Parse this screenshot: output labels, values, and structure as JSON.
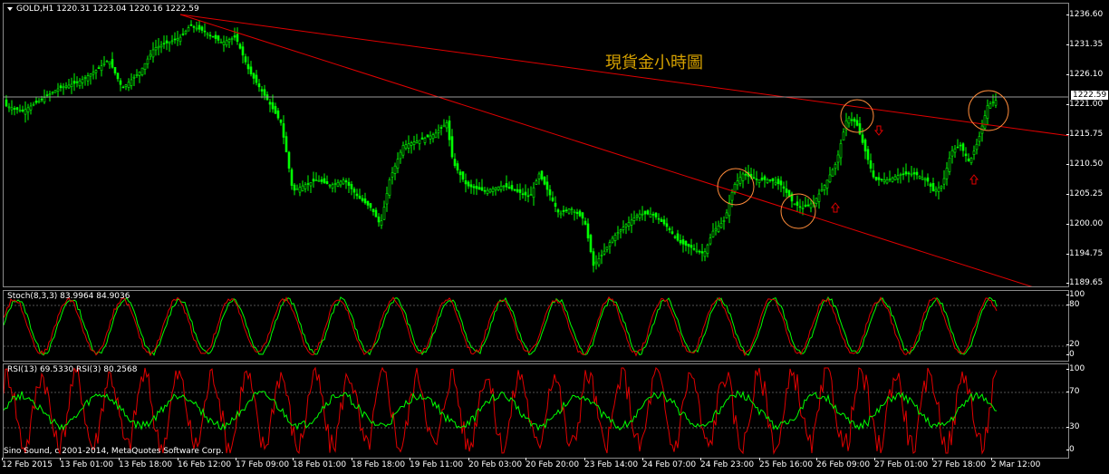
{
  "main": {
    "label": "GOLD,H1  1220.31 1223.04 1220.16 1222.59",
    "title": "現貨金小時圖",
    "current_price": "1222.59",
    "price_ticks": [
      "1236.60",
      "1231.35",
      "1226.10",
      "1221.00",
      "1215.75",
      "1210.50",
      "1205.25",
      "1200.00",
      "1194.75",
      "1189.65"
    ]
  },
  "stoch": {
    "label": "Stoch(8,3,3) 83.9964 84.9036",
    "ticks": [
      "100",
      "80",
      "20",
      "0"
    ]
  },
  "rsi": {
    "label": "RSI(13) 69.5330  RSI(3) 80.2568",
    "ticks": [
      "100",
      "70",
      "30",
      "0"
    ]
  },
  "copyright": "Sino Sound, c 2001-2014, MetaQuotes Software Corp.",
  "time_labels": [
    "12 Feb 2015",
    "13 Feb 01:00",
    "13 Feb 18:00",
    "16 Feb 12:00",
    "17 Feb 09:00",
    "18 Feb 01:00",
    "18 Feb 18:00",
    "19 Feb 11:00",
    "20 Feb 03:00",
    "20 Feb 20:00",
    "23 Feb 14:00",
    "24 Feb 07:00",
    "24 Feb 23:00",
    "25 Feb 16:00",
    "26 Feb 09:00",
    "27 Feb 01:00",
    "27 Feb 18:00",
    "2 Mar 12:00"
  ],
  "colors": {
    "candle": "#00ff00",
    "trendline": "#e00000",
    "stoch_main": "#e00000",
    "stoch_signal": "#00ff00",
    "rsi13": "#00ff00",
    "rsi3": "#e00000",
    "annotation": "#ff8c3a"
  }
}
